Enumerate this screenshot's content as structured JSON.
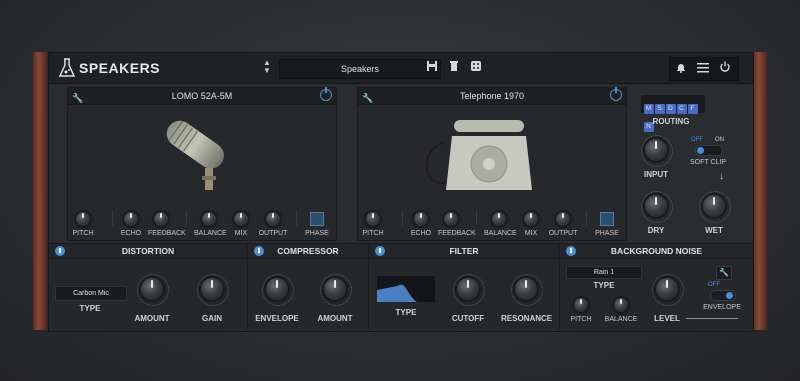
{
  "header": {
    "brand": "SPEAKERS",
    "preset": "Speakers"
  },
  "speaker_a": {
    "name": "LOMO 52A-5M",
    "knobs": [
      "PITCH",
      "ECHO",
      "FEEDBACK",
      "BALANCE",
      "MIX",
      "OUTPUT",
      "PHASE"
    ]
  },
  "speaker_b": {
    "name": "Telephone 1970",
    "knobs": [
      "PITCH",
      "ECHO",
      "FEEDBACK",
      "BALANCE",
      "MIX",
      "OUTPUT",
      "PHASE"
    ]
  },
  "routing": {
    "title": "ROUTING",
    "buttons": [
      "M",
      "S",
      "D",
      "C",
      "F",
      "N"
    ],
    "input": "INPUT",
    "off": "OFF",
    "on": "ON",
    "soft_clip": "SOFT CLIP",
    "dry": "DRY",
    "wet": "WET"
  },
  "distortion": {
    "title": "DISTORTION",
    "type_value": "Carbon Mic",
    "type": "TYPE",
    "amount": "AMOUNT",
    "gain": "GAIN"
  },
  "compressor": {
    "title": "COMPRESSOR",
    "envelope": "ENVELOPE",
    "amount": "AMOUNT"
  },
  "filter": {
    "title": "FILTER",
    "type": "TYPE",
    "cutoff": "CUTOFF",
    "resonance": "RESONANCE"
  },
  "noise": {
    "title": "BACKGROUND NOISE",
    "type_value": "Rain 1",
    "type": "TYPE",
    "pitch": "PITCH",
    "balance": "BALANCE",
    "level": "LEVEL",
    "off": "OFF",
    "envelope": "ENVELOPE"
  },
  "colors": {
    "accent": "#4a90d9",
    "routing": "#4a6cc9"
  }
}
